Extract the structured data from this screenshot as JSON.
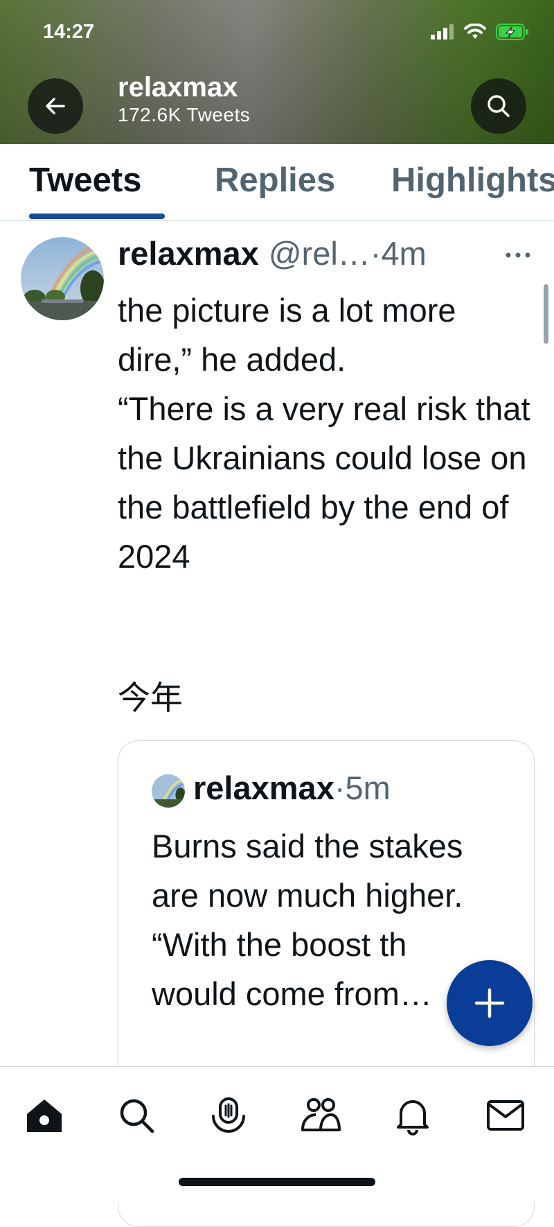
{
  "status_bar": {
    "time": "14:27",
    "icons": [
      "signal-icon",
      "wifi-icon",
      "battery-charging-icon"
    ]
  },
  "header": {
    "title": "relaxmax",
    "subtitle": "172.6K Tweets",
    "back_icon": "arrow-left-icon",
    "search_icon": "search-icon"
  },
  "tabs": [
    {
      "label": "Tweets",
      "active": true
    },
    {
      "label": "Replies",
      "active": false
    },
    {
      "label": "Highlights",
      "active": false
    }
  ],
  "tweet": {
    "display_name": "relaxmax",
    "handle": "@rel…",
    "separator": "·",
    "time": "4m",
    "more_icon": "more-horizontal-icon",
    "body_lines": [
      "the picture is a lot more dire,” he added.",
      "“There is a very real risk that the Ukrainians could lose on the battlefield by the end of 2024"
    ],
    "cjk_text": "今年"
  },
  "quoted_tweet": {
    "display_name": "relaxmax",
    "separator": "·",
    "time": "5m",
    "body_lines": [
      "Burns said the stakes are now much higher.",
      "“With the boost th would come from…"
    ]
  },
  "fab": {
    "icon": "compose-plus-icon"
  },
  "bottom_nav": [
    {
      "icon": "home-icon",
      "active": true
    },
    {
      "icon": "search-icon",
      "active": false
    },
    {
      "icon": "spaces-icon",
      "active": false
    },
    {
      "icon": "communities-icon",
      "active": false
    },
    {
      "icon": "notifications-icon",
      "active": false
    },
    {
      "icon": "messages-icon",
      "active": false
    }
  ],
  "colors": {
    "accent": "#1c4a9a",
    "fab": "#0a3d97",
    "text_primary": "#0f1419",
    "text_secondary": "#536471",
    "border": "#cfd9de"
  }
}
